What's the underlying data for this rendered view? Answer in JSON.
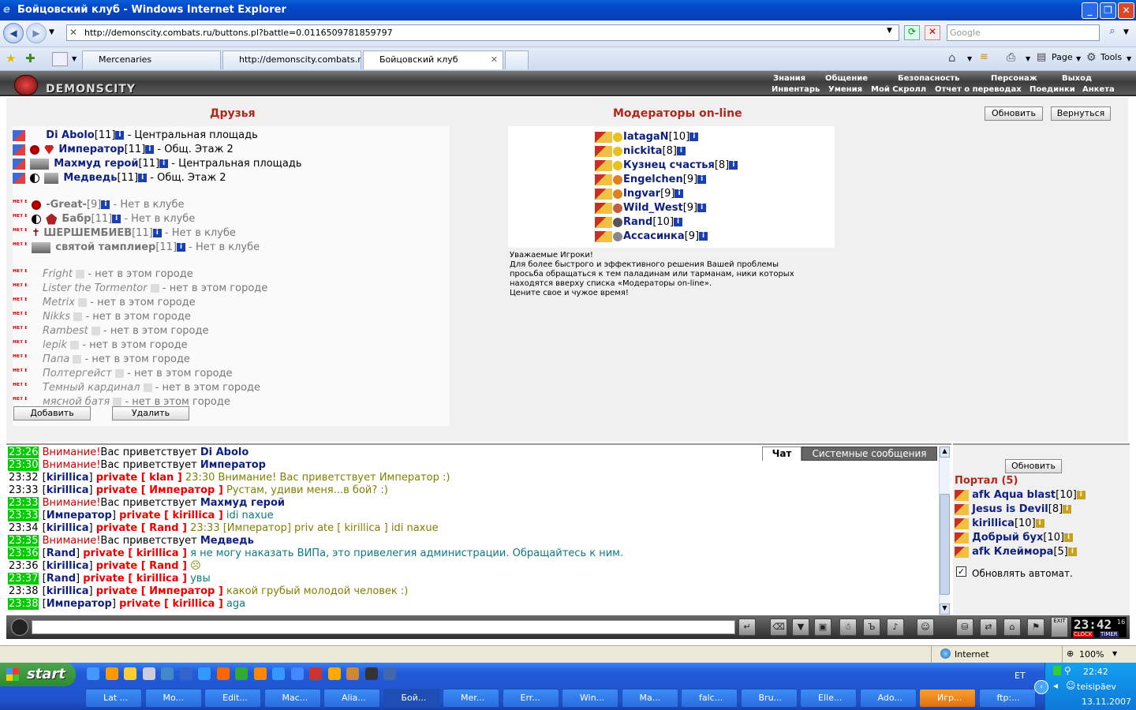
{
  "window": {
    "title": "Бойцовский клуб - Windows Internet Explorer"
  },
  "browser": {
    "url": "http://demonscity.combats.ru/buttons.pl?battle=0.0116509781859797",
    "search_placeholder": "Google",
    "tabs": [
      "Mercenaries",
      "http://demonscity.combats.r...",
      "Бойцовский клуб"
    ],
    "toolbar": {
      "page": "Page",
      "tools": "Tools"
    }
  },
  "game": {
    "logo": "DEMONSCITY",
    "menu_top": [
      "Знания",
      "Общение",
      "Безопасность",
      "Персонаж",
      "Выход"
    ],
    "menu_bottom": [
      "Инвентарь",
      "Умения",
      "Мой Скролл",
      "Отчет о переводах",
      "Поединки",
      "Анкета"
    ]
  },
  "friends": {
    "title": "Друзья",
    "online": [
      {
        "nick": "Di Abolo",
        "level": "[11]",
        "loc": " - Центральная площадь"
      },
      {
        "nick": "Император",
        "level": "[11]",
        "loc": " - Общ. Этаж 2"
      },
      {
        "nick": "Махмуд герой",
        "level": "[11]",
        "loc": " - Центральная площадь"
      },
      {
        "nick": "Медведь",
        "level": "[11]",
        "loc": " - Общ. Этаж 2"
      }
    ],
    "offline": [
      {
        "nick": "-Great-",
        "level": "[9]",
        "loc": " - Нет в клубе"
      },
      {
        "nick": "Бабр",
        "level": "[11]",
        "loc": " - Нет в клубе"
      },
      {
        "nick": "ШЕРШЕМБИЕВ",
        "level": "[11]",
        "loc": " - Нет в клубе"
      },
      {
        "nick": "святой тамплиер",
        "level": "[11]",
        "loc": " - Нет в клубе"
      }
    ],
    "other_city": [
      {
        "nick": "Fright",
        "loc": " - нет в этом городе"
      },
      {
        "nick": "Lister the Tormentor",
        "loc": " - нет в этом городе"
      },
      {
        "nick": "Metrix",
        "loc": " - нет в этом городе"
      },
      {
        "nick": "Nikks",
        "loc": " - нет в этом городе"
      },
      {
        "nick": "Rambest",
        "loc": " - нет в этом городе"
      },
      {
        "nick": "lepik",
        "loc": " - нет в этом городе"
      },
      {
        "nick": "Папа",
        "loc": " - нет в этом городе"
      },
      {
        "nick": "Полтергейст",
        "loc": " - нет в этом городе"
      },
      {
        "nick": "Темный кардинал",
        "loc": " - нет в этом городе"
      },
      {
        "nick": "мясной батя",
        "loc": " - нет в этом городе"
      }
    ],
    "offline_badge": "НЕТ В КЛУБЕ",
    "add_button": "Добавить",
    "remove_button": "Удалить"
  },
  "moderators": {
    "title": "Модераторы on-line",
    "list": [
      {
        "nick": "IatagaN",
        "level": "[10]"
      },
      {
        "nick": "nickita",
        "level": "[8]"
      },
      {
        "nick": "Кузнец счастья",
        "level": "[8]"
      },
      {
        "nick": "Engelchen",
        "level": "[9]"
      },
      {
        "nick": "Ingvar",
        "level": "[9]"
      },
      {
        "nick": "Wild_West",
        "level": "[9]"
      },
      {
        "nick": "Rand",
        "level": "[10]"
      },
      {
        "nick": "Ассасинка",
        "level": "[9]"
      }
    ],
    "note": "Уважаемые Игроки!\nДля более быстрого и эффективного решения Вашей проблемы\nпросьба обращаться к тем паладинам или тарманам, ники которых\nнаходятся вверху списка «Модераторы on-line».\nЦените свое и чужое время!",
    "refresh_button": "Обновить",
    "back_button": "Вернуться"
  },
  "chat": {
    "tab_chat": "Чат",
    "tab_system": "Системные сообщения",
    "lines": [
      {
        "time": "23:26",
        "hl": true,
        "parts": [
          [
            "warn",
            "Внимание!"
          ],
          [
            "",
            "Вас приветствует "
          ],
          [
            "cnick",
            "Di Abolo"
          ]
        ]
      },
      {
        "time": "23:30",
        "hl": true,
        "parts": [
          [
            "warn",
            "Внимание!"
          ],
          [
            "",
            "Вас приветствует "
          ],
          [
            "cnick",
            "Император"
          ]
        ]
      },
      {
        "time": "23:32",
        "hl": false,
        "parts": [
          [
            "",
            "["
          ],
          [
            "cnick",
            "kirillica"
          ],
          [
            "",
            "] "
          ],
          [
            "priv",
            "private [ klan ]"
          ],
          [
            "pmsg",
            " 23:30 Внимание! Вас приветствует Император :)"
          ]
        ]
      },
      {
        "time": "23:33",
        "hl": false,
        "parts": [
          [
            "",
            "["
          ],
          [
            "cnick",
            "kirillica"
          ],
          [
            "",
            "] "
          ],
          [
            "priv",
            "private [ Император ]"
          ],
          [
            "pmsg",
            " Рустам, удиви меня...в бой? :)"
          ]
        ]
      },
      {
        "time": "23:33",
        "hl": true,
        "parts": [
          [
            "warn",
            "Внимание!"
          ],
          [
            "",
            "Вас приветствует "
          ],
          [
            "cnick",
            "Махмуд герой"
          ]
        ]
      },
      {
        "time": "23:33",
        "hl": true,
        "parts": [
          [
            "",
            "["
          ],
          [
            "cnick",
            "Император"
          ],
          [
            "",
            "] "
          ],
          [
            "priv",
            "private [ kirillica ]"
          ],
          [
            "grn",
            " idi naxue"
          ]
        ]
      },
      {
        "time": "23:34",
        "hl": false,
        "parts": [
          [
            "",
            "["
          ],
          [
            "cnick",
            "kirillica"
          ],
          [
            "",
            "] "
          ],
          [
            "priv",
            "private [ Rand ]"
          ],
          [
            "pmsg",
            " 23:33 [Император] priv ate [ kirillica ] idi naxue"
          ]
        ]
      },
      {
        "time": "23:35",
        "hl": true,
        "parts": [
          [
            "warn",
            "Внимание!"
          ],
          [
            "",
            "Вас приветствует "
          ],
          [
            "cnick",
            "Медведь"
          ]
        ]
      },
      {
        "time": "23:36",
        "hl": true,
        "parts": [
          [
            "",
            "["
          ],
          [
            "cnick",
            "Rand"
          ],
          [
            "",
            "] "
          ],
          [
            "priv",
            "private [ kirillica ]"
          ],
          [
            "grn",
            " я не могу наказать ВИПа, это привелегия администрации. Обращайтесь к ним."
          ]
        ]
      },
      {
        "time": "23:36",
        "hl": false,
        "parts": [
          [
            "",
            "["
          ],
          [
            "cnick",
            "kirillica"
          ],
          [
            "",
            "] "
          ],
          [
            "priv",
            "private [ Rand ]"
          ],
          [
            "pmsg",
            " ☹"
          ]
        ]
      },
      {
        "time": "23:37",
        "hl": true,
        "parts": [
          [
            "",
            "["
          ],
          [
            "cnick",
            "Rand"
          ],
          [
            "",
            "] "
          ],
          [
            "priv",
            "private [ kirillica ]"
          ],
          [
            "grn",
            " увы"
          ]
        ]
      },
      {
        "time": "23:38",
        "hl": false,
        "parts": [
          [
            "",
            "["
          ],
          [
            "cnick",
            "kirillica"
          ],
          [
            "",
            "] "
          ],
          [
            "priv",
            "private [ Император ]"
          ],
          [
            "pmsg",
            " какой грубый молодой человек :)"
          ]
        ]
      },
      {
        "time": "23:38",
        "hl": true,
        "parts": [
          [
            "",
            "["
          ],
          [
            "cnick",
            "Император"
          ],
          [
            "",
            "] "
          ],
          [
            "priv",
            "private [ kirillica ]"
          ],
          [
            "grn",
            " aga"
          ]
        ]
      }
    ]
  },
  "online": {
    "refresh_button": "Обновить",
    "room_title": "Портал (5)",
    "users": [
      {
        "nick": "afk Aqua blast",
        "level": "[10]"
      },
      {
        "nick": "Jesus is Devil",
        "level": "[8]"
      },
      {
        "nick": "kirillica",
        "level": "[10]"
      },
      {
        "nick": "Добрый бух",
        "level": "[10]"
      },
      {
        "nick": "afk Клеймора",
        "level": "[5]"
      }
    ],
    "auto_refresh": "Обновлять автомат."
  },
  "clock": {
    "time": "23:42",
    "sec": "16",
    "clock_label": "CLOCK",
    "timer_label": "TIMER",
    "exit": "EXIT"
  },
  "statusbar": {
    "zone": "Internet",
    "zoom": "100%"
  },
  "taskbar": {
    "start": "start",
    "lang": "ET",
    "items": [
      "Lat ...",
      "Mo...",
      "Edit...",
      "Mac...",
      "Alia...",
      "Бой...",
      "Mer...",
      "Err...",
      "Win...",
      "Ma...",
      "falc...",
      "Bru...",
      "Elle...",
      "Ado...",
      "Игр...",
      "ftp:..."
    ],
    "time": "22:42",
    "day": "teisipäev",
    "date": "13.11.2007"
  }
}
